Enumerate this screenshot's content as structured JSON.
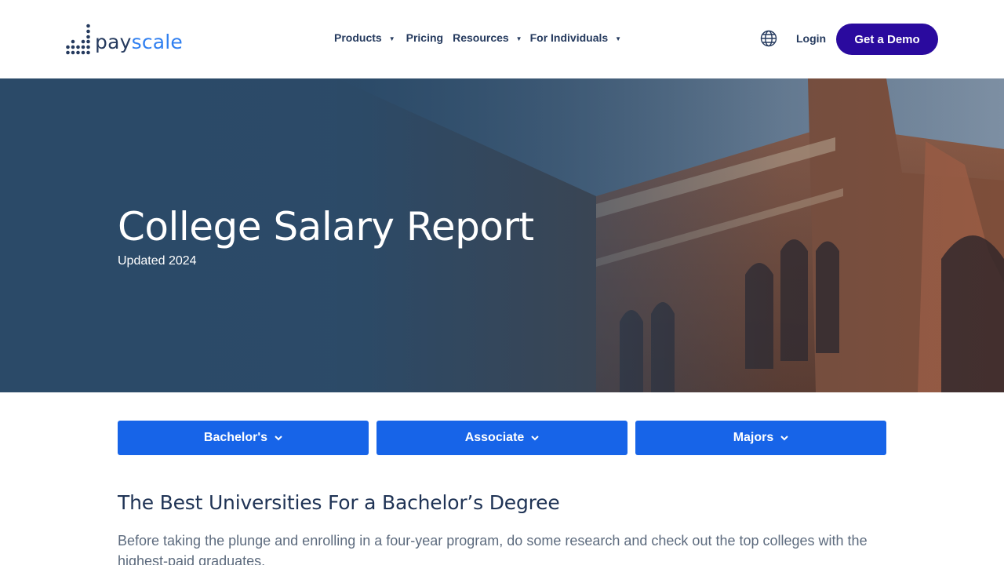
{
  "header": {
    "logo": {
      "pay": "pay",
      "scale": "scale"
    },
    "nav": [
      {
        "label": "Products",
        "has_dropdown": true
      },
      {
        "label": "Pricing",
        "has_dropdown": false
      },
      {
        "label": "Resources",
        "has_dropdown": true
      },
      {
        "label": "For Individuals",
        "has_dropdown": true
      }
    ],
    "globe_icon": "globe-icon",
    "login_label": "Login",
    "demo_label": "Get a Demo"
  },
  "hero": {
    "title": "College Salary Report",
    "subtitle": "Updated 2024"
  },
  "tabs": [
    {
      "label": "Bachelor's",
      "icon": "chevron-down-icon"
    },
    {
      "label": "Associate",
      "icon": "chevron-down-icon"
    },
    {
      "label": "Majors",
      "icon": "chevron-down-icon"
    }
  ],
  "section": {
    "title": "The Best Universities For a Bachelor’s Degree",
    "body": "Before taking the plunge and enrolling in a four-year program, do some research and check out the top colleges with the highest-paid graduates."
  },
  "colors": {
    "brand_dark": "#253a5e",
    "brand_blue": "#2f7ff0",
    "demo_button": "#2a0a9e",
    "tab_blue": "#1764e8",
    "hero_overlay": "#2b4a68"
  }
}
